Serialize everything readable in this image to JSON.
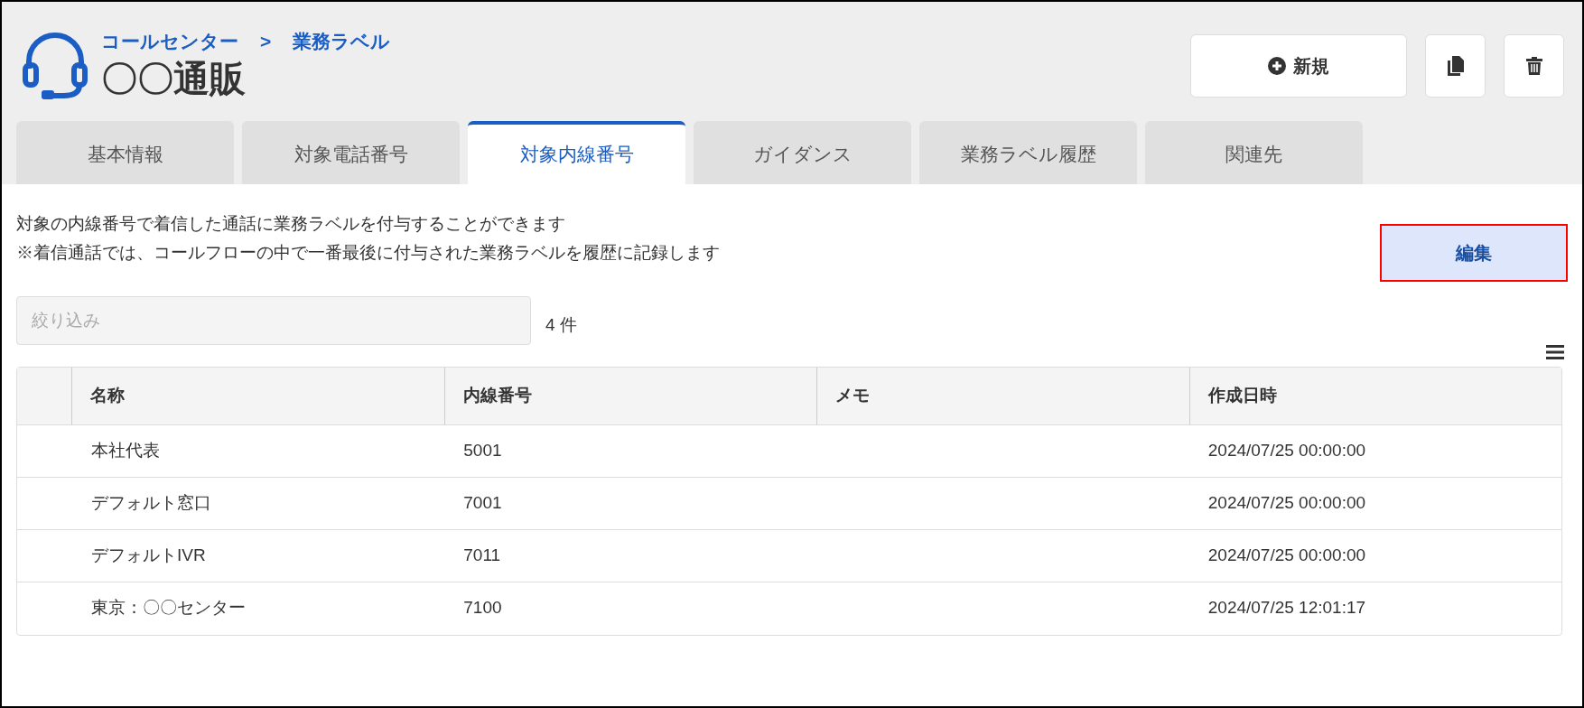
{
  "breadcrumb": [
    {
      "label": "コールセンター"
    },
    {
      "label": ">"
    },
    {
      "label": "業務ラベル"
    }
  ],
  "title": "〇〇通販",
  "actions": {
    "new_label": "新規"
  },
  "tabs": [
    {
      "label": "基本情報",
      "selected": false
    },
    {
      "label": "対象電話番号",
      "selected": false
    },
    {
      "label": "対象内線番号",
      "selected": true
    },
    {
      "label": "ガイダンス",
      "selected": false
    },
    {
      "label": "業務ラベル履歴",
      "selected": false
    },
    {
      "label": "関連先",
      "selected": false
    }
  ],
  "description": [
    "対象の内線番号で着信した通話に業務ラベルを付与することができます",
    "※着信通話では、コールフローの中で一番最後に付与された業務ラベルを履歴に記録します"
  ],
  "edit_button": "編集",
  "filter": {
    "placeholder": "絞り込み"
  },
  "count": "4 件",
  "table": {
    "columns": [
      "名称",
      "内線番号",
      "メモ",
      "作成日時"
    ],
    "rows": [
      {
        "name": "本社代表",
        "extension": "5001",
        "created": "2024/07/25 00:00:00"
      },
      {
        "name": "デフォルト窓口",
        "extension": "7001",
        "created": "2024/07/25 00:00:00"
      },
      {
        "name": "デフォルトIVR",
        "extension": "7011",
        "created": "2024/07/25 00:00:00"
      },
      {
        "name": "東京：〇〇センター",
        "extension": "7100",
        "created": "2024/07/25 12:01:17"
      }
    ]
  }
}
